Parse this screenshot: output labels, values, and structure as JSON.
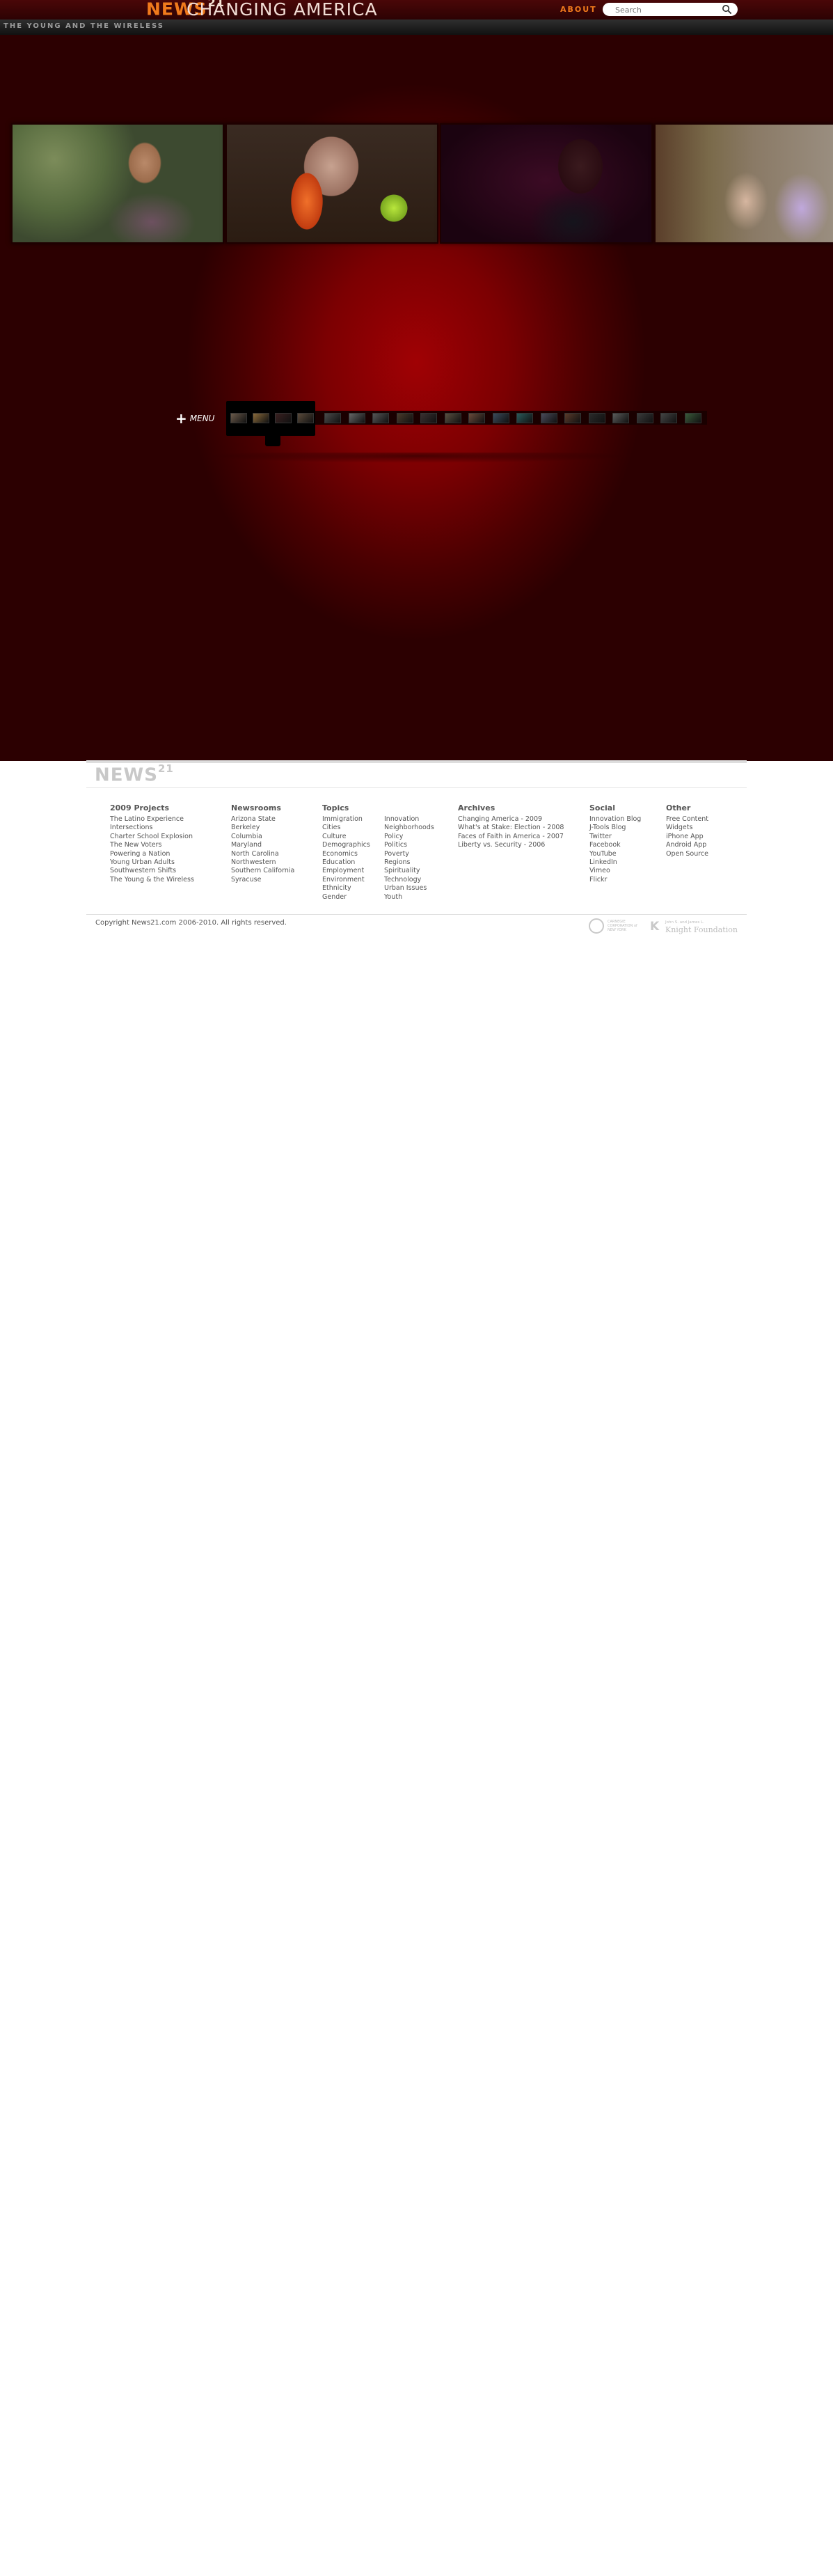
{
  "header": {
    "logo": "NEWS",
    "logo_sup": "21",
    "site_title": "CHANGING AMERICA",
    "about_label": "ABOUT",
    "search_placeholder": "Search"
  },
  "subheader": {
    "project_title": "THE YOUNG AND THE WIRELESS"
  },
  "stage": {
    "menu_label": "MENU",
    "menu_icon": "plus-icon",
    "photos": [
      "photo-1",
      "photo-2",
      "photo-3",
      "photo-4"
    ],
    "thumbnail_count": 20,
    "accent": "#a00104"
  },
  "footer": {
    "logo": "NEWS",
    "logo_sup": "21",
    "columns": [
      {
        "title": "2009 Projects",
        "items": [
          "The Latino Experience",
          "Intersections",
          "Charter School Explosion",
          "The New Voters",
          "Powering a Nation",
          "Young Urban Adults",
          "Southwestern Shifts",
          "The Young & the Wireless"
        ]
      },
      {
        "title": "Newsrooms",
        "items": [
          "Arizona State",
          "Berkeley",
          "Columbia",
          "Maryland",
          "North Carolina",
          "Northwestern",
          "Southern California",
          "Syracuse"
        ]
      },
      {
        "title": "Topics",
        "items": [
          "Immigration",
          "Cities",
          "Culture",
          "Demographics",
          "Economics",
          "Education",
          "Employment",
          "Environment",
          "Ethnicity",
          "Gender"
        ]
      },
      {
        "title": "",
        "items": [
          "Innovation",
          "Neighborhoods",
          "Policy",
          "Politics",
          "Poverty",
          "Regions",
          "Spirituality",
          "Technology",
          "Urban Issues",
          "Youth"
        ]
      },
      {
        "title": "Archives",
        "items": [
          "Changing America - 2009",
          "What's at Stake: Election - 2008",
          "Faces of Faith in America - 2007",
          "Liberty vs. Security - 2006"
        ]
      },
      {
        "title": "Social",
        "items": [
          "Innovation Blog",
          "J-Tools Blog",
          "Twitter",
          "Facebook",
          "YouTube",
          "LinkedIn",
          "Vimeo",
          "Flickr"
        ]
      },
      {
        "title": "Other",
        "items": [
          "Free Content",
          "Widgets",
          "iPhone App",
          "Android App",
          "Open Source"
        ]
      }
    ],
    "copyright": "Copyright News21.com 2006-2010. All rights reserved.",
    "sponsor_1": "CARNEGIE CORPORATION of NEW YORK",
    "sponsor_2_line1": "John S. and James L.",
    "sponsor_2_line2": "Knight Foundation"
  }
}
